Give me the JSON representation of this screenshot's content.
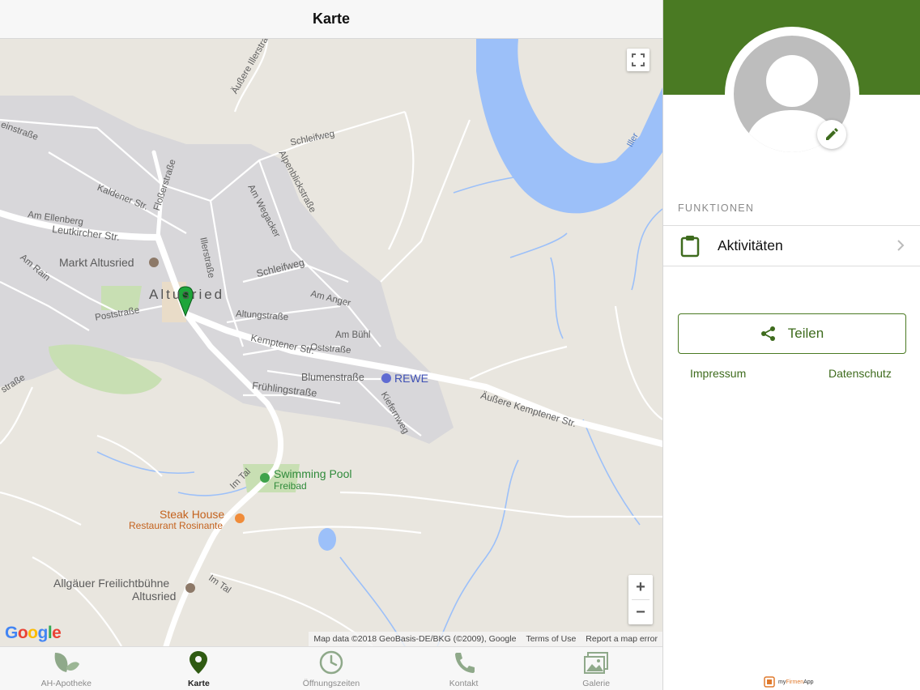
{
  "navbar": {
    "title": "Karte"
  },
  "map": {
    "labels": {
      "aeussere_illerstrasse": "Äußere Illerstraße",
      "schleifweg_top": "Schleifweg",
      "einsstrasse": "einstraße",
      "alpenblickstrasse": "Alpenblickstraße",
      "am_wegacker": "Am Wegacker",
      "kaldener_str": "Kaldener Str.",
      "flosserstrasse": "Floßerstraße",
      "am_ellenberg": "Am Ellenberg",
      "leutkircher_str": "Leutkircher Str.",
      "illerstrasse": "Illerstraße",
      "am_rain": "Am Rain",
      "markt_altusried": "Markt Altusried",
      "schleifweg": "Schleifweg",
      "altusried": "Altusried",
      "am_anger": "Am Anger",
      "poststrasse": "Poststraße",
      "altungstrasse": "Altungstraße",
      "am_buehl": "Am Bühl",
      "kemptener_str": "Kemptener Str.",
      "oststrasse": "Oststraße",
      "blumenstrasse": "Blumenstraße",
      "rewe": "REWE",
      "fruehlingstrasse": "Frühlingstraße",
      "kiefernweg": "Kiefernweg",
      "aeussere_kemptener_str": "Äußere Kemptener Str.",
      "im_tal": "Im Tal",
      "im_tal_2": "Im Tal",
      "swimming_pool": "Swimming Pool",
      "freibad": "Freibad",
      "steak_house": "Steak House",
      "restaurant_rosinante": "Restaurant Rosinante",
      "allgaeuer_freilichtbuehne": "Allgäuer Freilichtbühne",
      "altusried_2": "Altusried",
      "iller": "Iller",
      "strasse_left": "straße"
    },
    "zoom_in": "+",
    "zoom_out": "−",
    "google_logo": {
      "G": "G",
      "o1": "o",
      "o2": "o",
      "g": "g",
      "l": "l",
      "e": "e"
    },
    "attribution": {
      "map_data": "Map data ©2018 GeoBasis-DE/BKG (©2009), Google",
      "terms": "Terms of Use",
      "report": "Report a map error"
    },
    "colors": {
      "land": "#e9e6df",
      "water": "#9cc0f9",
      "town": "#d7d6d8",
      "road": "#ffffff",
      "green": "#c8dfb3",
      "pin": "#1ea53a"
    }
  },
  "tabbar": {
    "tabs": [
      {
        "label": "AH-Apotheke",
        "icon": "leaf-icon"
      },
      {
        "label": "Karte",
        "icon": "map-pin-icon",
        "active": true
      },
      {
        "label": "Öffnungszeiten",
        "icon": "clock-icon"
      },
      {
        "label": "Kontakt",
        "icon": "phone-icon"
      },
      {
        "label": "Galerie",
        "icon": "gallery-icon"
      }
    ]
  },
  "panel": {
    "section_title": "FUNKTIONEN",
    "activities_label": "Aktivitäten",
    "share_label": "Teilen",
    "impressum": "Impressum",
    "datenschutz": "Datenschutz",
    "brand_prefix": "my",
    "brand_highlight": "Firmen",
    "brand_suffix": "App",
    "accent_color": "#4a7a23"
  }
}
